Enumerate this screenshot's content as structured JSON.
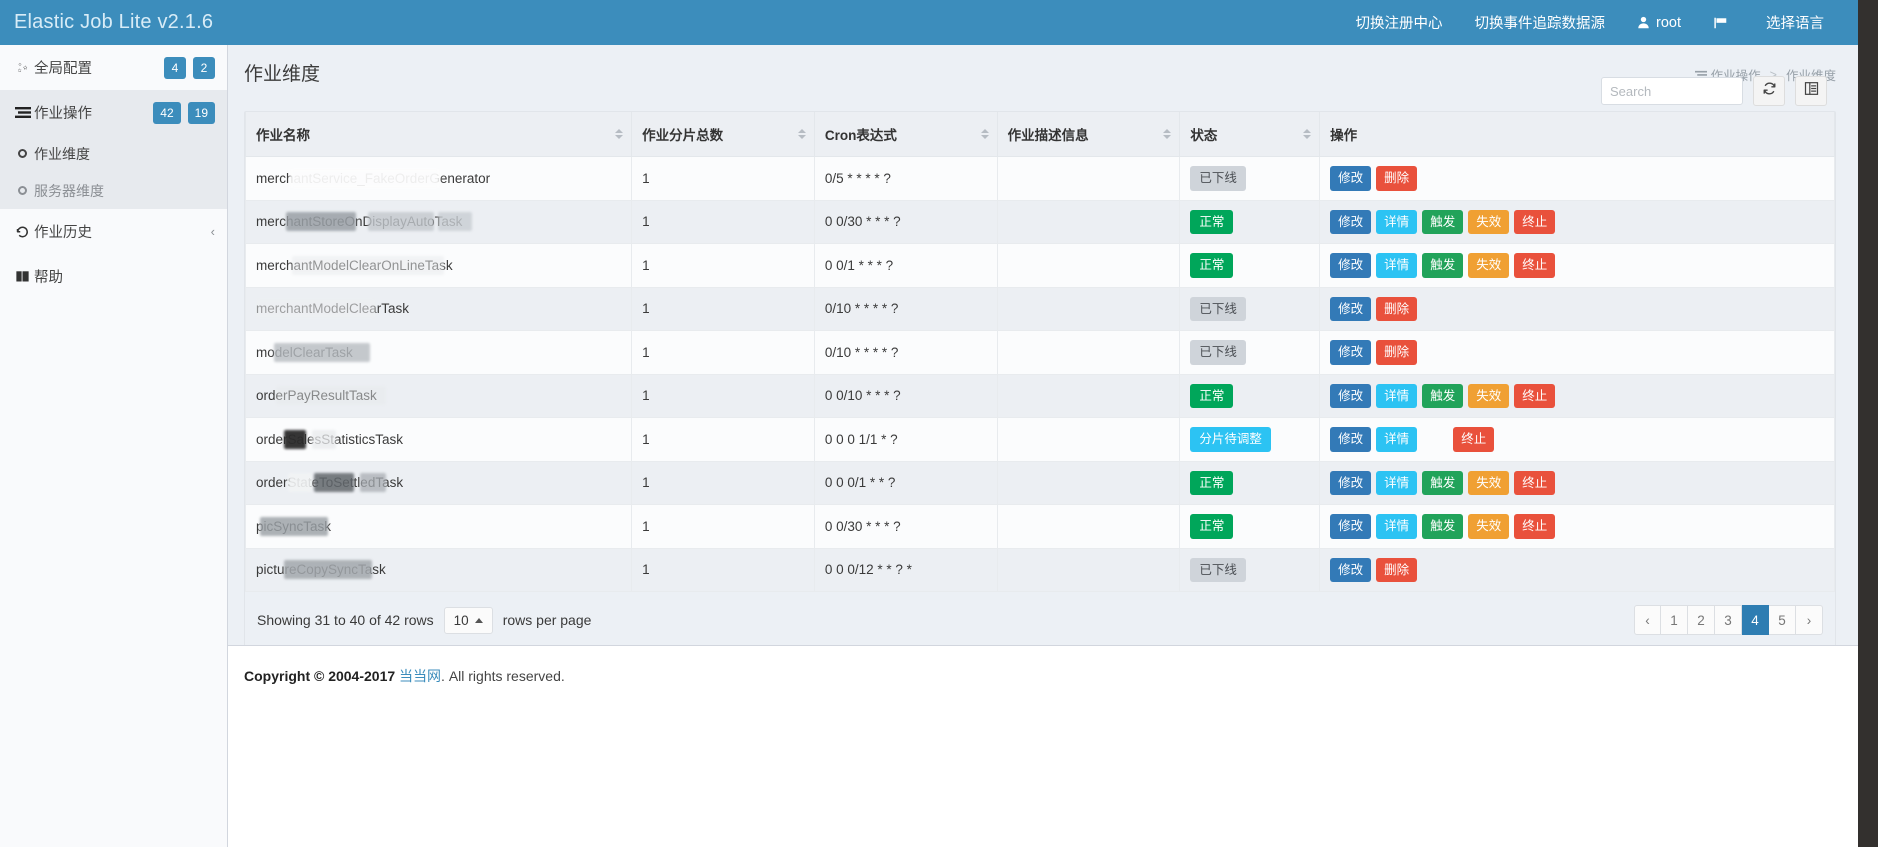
{
  "navbar": {
    "brand": "Elastic Job Lite v2.1.6",
    "items": [
      {
        "label": "切换注册中心",
        "icon": ""
      },
      {
        "label": "切换事件追踪数据源",
        "icon": ""
      },
      {
        "label": "root",
        "icon": "user-icon"
      },
      {
        "label": "",
        "icon": "flag-icon"
      },
      {
        "label": "选择语言",
        "icon": ""
      }
    ]
  },
  "sidebar": {
    "items": [
      {
        "label": "全局配置",
        "icon": "gears-icon",
        "badges": [
          "4",
          "2"
        ]
      },
      {
        "label": "作业操作",
        "icon": "tasks-icon",
        "badges": [
          "42",
          "19"
        ]
      }
    ],
    "subitems": [
      {
        "label": "作业维度",
        "active": true
      },
      {
        "label": "服务器维度",
        "active": false
      }
    ],
    "history": {
      "label": "作业历史",
      "icon": "history-icon",
      "chevron": "‹"
    },
    "help": {
      "label": "帮助",
      "icon": "book-icon"
    }
  },
  "page": {
    "title": "作业维度",
    "breadcrumb": {
      "parent": "作业操作",
      "separator": ">",
      "current": "作业维度"
    }
  },
  "toolbar": {
    "search_placeholder": "Search",
    "search_value": "",
    "refresh_title": "refresh",
    "columns_title": "columns"
  },
  "table": {
    "columns": [
      {
        "label": "作业名称",
        "sortable": true
      },
      {
        "label": "作业分片总数",
        "sortable": true
      },
      {
        "label": "Cron表达式",
        "sortable": true
      },
      {
        "label": "作业描述信息",
        "sortable": true
      },
      {
        "label": "状态",
        "sortable": true
      },
      {
        "label": "操作",
        "sortable": false
      }
    ],
    "rows": [
      {
        "name": "merchantService_FakeOrderGenerator",
        "name_visible_prefix": "merc",
        "shards": "1",
        "cron": "0/5 * * * * ?",
        "desc": "",
        "status": "已下线",
        "status_type": "offline",
        "actions": [
          "修改",
          "删除"
        ]
      },
      {
        "name": "merchantStoreOnDisplayAutoTask",
        "name_visible_prefix": "merc",
        "shards": "1",
        "cron": "0 0/30 * * * ?",
        "desc": "",
        "status": "正常",
        "status_type": "ok",
        "actions": [
          "修改",
          "详情",
          "触发",
          "失效",
          "终止"
        ]
      },
      {
        "name": "merchantModelClearOnLineTask",
        "name_visible_prefix": "merc",
        "shards": "1",
        "cron": "0 0/1 * * * ?",
        "desc": "",
        "status": "正常",
        "status_type": "ok",
        "actions": [
          "修改",
          "详情",
          "触发",
          "失效",
          "终止"
        ]
      },
      {
        "name": "merchantModelClearTask",
        "name_visible_prefix": "",
        "shards": "1",
        "cron": "0/10 * * * * ?",
        "desc": "",
        "status": "已下线",
        "status_type": "offline",
        "actions": [
          "修改",
          "删除"
        ]
      },
      {
        "name": "modelClearTask",
        "name_visible_prefix": "m",
        "shards": "1",
        "cron": "0/10 * * * * ?",
        "desc": "",
        "status": "已下线",
        "status_type": "offline",
        "actions": [
          "修改",
          "删除"
        ]
      },
      {
        "name": "orderPayResultTask",
        "name_visible_prefix": "ord",
        "shards": "1",
        "cron": "0 0/10 * * * ?",
        "desc": "",
        "status": "正常",
        "status_type": "ok",
        "actions": [
          "修改",
          "详情",
          "触发",
          "失效",
          "终止"
        ]
      },
      {
        "name": "orderSalesStatisticsTask",
        "name_visible_prefix": "ord",
        "shards": "1",
        "cron": "0 0 0 1/1 * ?",
        "desc": "",
        "status": "分片待调整",
        "status_type": "pending",
        "actions": [
          "修改",
          "详情",
          "终止"
        ]
      },
      {
        "name": "orderStateToSettledTask",
        "name_visible_prefix": "orde",
        "shards": "1",
        "cron": "0 0 0/1 * * ?",
        "desc": "",
        "status": "正常",
        "status_type": "ok",
        "actions": [
          "修改",
          "详情",
          "触发",
          "失效",
          "终止"
        ]
      },
      {
        "name": "picSyncTask",
        "name_visible_prefix": "p",
        "shards": "1",
        "cron": "0 0/30 * * * ?",
        "desc": "",
        "status": "正常",
        "status_type": "ok",
        "actions": [
          "修改",
          "详情",
          "触发",
          "失效",
          "终止"
        ]
      },
      {
        "name": "pictureCopySyncTask",
        "name_visible_prefix": "pict",
        "shards": "1",
        "cron": "0 0 0/12 * * ? *",
        "desc": "",
        "status": "已下线",
        "status_type": "offline",
        "actions": [
          "修改",
          "删除"
        ]
      }
    ]
  },
  "pagination": {
    "showing_text": "Showing 31 to 40 of 42 rows",
    "rows_per_page_value": "10",
    "rows_per_page_label": "rows per page",
    "prev": "‹",
    "next": "›",
    "pages": [
      "1",
      "2",
      "3",
      "4",
      "5"
    ],
    "active_page": "4"
  },
  "footer": {
    "prefix": "Copyright © 2004-2017 ",
    "link": "当当网",
    "suffix": ". All rights reserved."
  },
  "colors": {
    "primary": "#3c8dbc",
    "success": "#00a65a",
    "info": "#2cc3f3",
    "warning": "#f0a033",
    "danger": "#e9513c",
    "edit": "#337ab7"
  }
}
